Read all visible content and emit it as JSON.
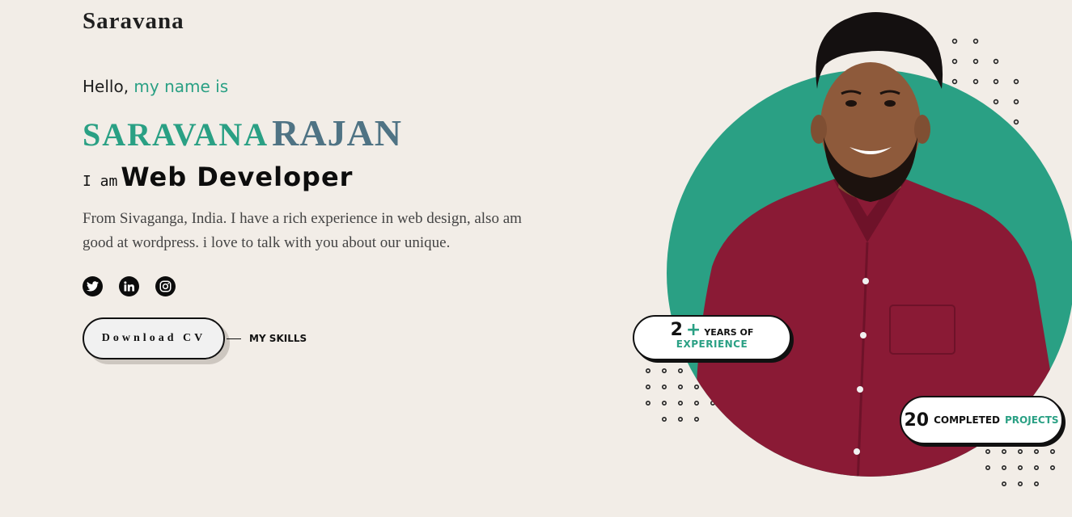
{
  "header": {
    "logo": "Saravana"
  },
  "intro": {
    "hello": "Hello,",
    "hello_accent": "my name is",
    "first_name": "SARAVANA",
    "last_name": "RAJAN",
    "i_am": "I am",
    "role": "Web Developer",
    "description": "From Sivaganga, India. I have a rich experience in web design, also am good at wordpress. i love to talk with you about our unique."
  },
  "socials": [
    {
      "icon": "twitter-icon"
    },
    {
      "icon": "linkedin-icon"
    },
    {
      "icon": "instagram-icon"
    }
  ],
  "actions": {
    "download_cv": "Download CV",
    "my_skills": "MY SKILLS"
  },
  "stats": {
    "experience_number": "2",
    "experience_plus": "+",
    "experience_label": "YEARS OF",
    "experience_accent": "EXPERIENCE",
    "projects_number": "20",
    "projects_label": "COMPLETED",
    "projects_accent": "PROJECTS"
  },
  "colors": {
    "accent": "#2aa084",
    "name_last": "#4f7384",
    "background": "#f2ede7",
    "shirt": "#8a1a35"
  }
}
